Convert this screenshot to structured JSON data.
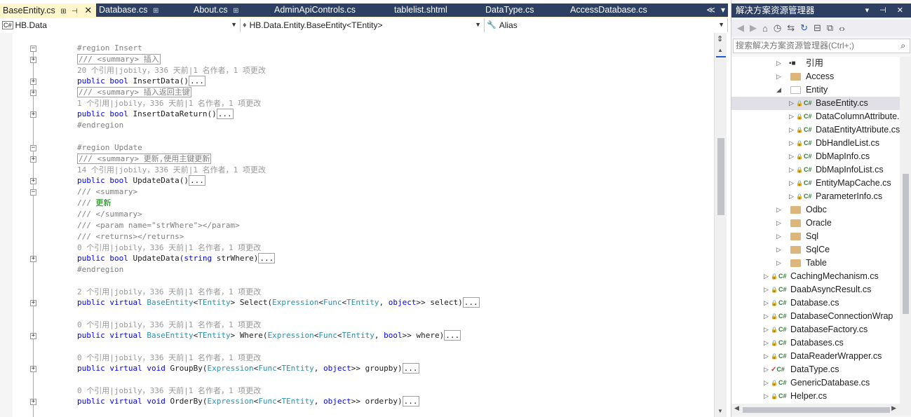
{
  "tabs": [
    {
      "label": "BaseEntity.cs",
      "active": true,
      "pin": "⊞",
      "pin2": "⊣",
      "close": "✕"
    },
    {
      "label": "Database.cs",
      "pin": "⊞"
    },
    {
      "label": "About.cs",
      "pin": "⊞"
    },
    {
      "label": "AdminApiControls.cs"
    },
    {
      "label": "tablelist.shtml"
    },
    {
      "label": "DataType.cs"
    },
    {
      "label": "AccessDatabase.cs"
    }
  ],
  "tab_overflow": {
    "left": "≪",
    "menu": "▾"
  },
  "navbar": {
    "project": "HB.Data",
    "project_icon": "C#",
    "class": "HB.Data.Entity.BaseEntity<TEntity>",
    "member": "Alias"
  },
  "code": {
    "region_insert": "#region Insert",
    "sum_insert": "/// <summary> 插入",
    "lens1": "20 个引用|jobily，336 天前|1 名作者，1 项更改",
    "insertdata_a": "public bool ",
    "insertdata_b": "InsertData()",
    "ellipsis": "...",
    "sum_insert_ret": "/// <summary> 插入返回主键",
    "lens2": "1 个引用|jobily，336 天前|1 名作者，1 项更改",
    "insertret_b": "InsertDataReturn()",
    "endregion": "#endregion",
    "region_update": "#region Update",
    "sum_update": "/// <summary> 更新,使用主键更新",
    "lens3": "14 个引用|jobily，336 天前|1 名作者，1 项更改",
    "updatedata_b": "UpdateData()",
    "doc_summary": "/// <summary>",
    "doc_prefix": "/// ",
    "doc_update_text": "更新",
    "doc_summary_end": "/// </summary>",
    "doc_param": "/// <param name=\"strWhere\"></param>",
    "doc_returns": "/// <returns></returns>",
    "lens4": "0 个引用|jobily，336 天前|1 名作者，1 项更改",
    "updatestr_kw1": "public bool ",
    "updatestr_b": "UpdateData(",
    "kw_string": "string",
    "updatestr_c": " strWhere)",
    "endregion2": "#endregion",
    "lens5": "2 个引用|jobily，336 天前|1 名作者，1 项更改",
    "pv": "public virtual ",
    "t_baseentity": "BaseEntity",
    "t_lt": "<",
    "t_tentity": "TEntity",
    "t_gt": "> ",
    "select_name": "Select(",
    "t_expr": "Expression",
    "t_func": "Func",
    "comma": ", ",
    "kw_object": "object",
    "select_tail": ">> select)",
    "lens6": "0 个引用|jobily，336 天前|1 名作者，1 项更改",
    "where_name": "Where(",
    "kw_bool": "bool",
    "where_tail": ">> where)",
    "lens7": "0 个引用|jobily，336 天前|1 名作者，1 项更改",
    "kw_void": "void ",
    "groupby_name": "GroupBy(",
    "groupby_tail": ">> groupby)",
    "lens8": "0 个引用|jobily，336 天前|1 名作者，1 项更改",
    "orderby_name": "OrderBy(",
    "orderby_tail": ">> orderby)"
  },
  "solution_explorer": {
    "title": "解决方案资源管理器",
    "title_controls": "▾ ⊣ ✕",
    "search_placeholder": "搜索解决方案资源管理器(Ctrl+;)",
    "toolbar_icons": [
      "back-icon",
      "forward-icon",
      "home-icon",
      "history-icon",
      "sync-icon",
      "refresh-icon",
      "collapse-all-icon",
      "copy-icon",
      "code-view-icon"
    ],
    "items": [
      {
        "label": "引用",
        "kind": "ref",
        "level": 1
      },
      {
        "label": "Access",
        "kind": "folder",
        "level": 1
      },
      {
        "label": "Entity",
        "kind": "folder-open",
        "level": 1,
        "expanded": true
      },
      {
        "label": "BaseEntity.cs",
        "kind": "cs",
        "level": 2,
        "selected": true
      },
      {
        "label": "DataColumnAttribute.cs",
        "kind": "cs",
        "level": 2
      },
      {
        "label": "DataEntityAttribute.cs",
        "kind": "cs",
        "level": 2
      },
      {
        "label": "DbHandleList.cs",
        "kind": "cs",
        "level": 2
      },
      {
        "label": "DbMapInfo.cs",
        "kind": "cs",
        "level": 2
      },
      {
        "label": "DbMapInfoList.cs",
        "kind": "cs",
        "level": 2
      },
      {
        "label": "EntityMapCache.cs",
        "kind": "cs",
        "level": 2
      },
      {
        "label": "ParameterInfo.cs",
        "kind": "cs",
        "level": 2
      },
      {
        "label": "Odbc",
        "kind": "folder",
        "level": 1
      },
      {
        "label": "Oracle",
        "kind": "folder",
        "level": 1
      },
      {
        "label": "Sql",
        "kind": "folder",
        "level": 1
      },
      {
        "label": "SqlCe",
        "kind": "folder",
        "level": 1
      },
      {
        "label": "Table",
        "kind": "folder",
        "level": 1
      },
      {
        "label": "CachingMechanism.cs",
        "kind": "cs",
        "level": 0
      },
      {
        "label": "DaabAsyncResult.cs",
        "kind": "cs",
        "level": 0
      },
      {
        "label": "Database.cs",
        "kind": "cs",
        "level": 0
      },
      {
        "label": "DatabaseConnectionWrap",
        "kind": "cs",
        "level": 0
      },
      {
        "label": "DatabaseFactory.cs",
        "kind": "cs",
        "level": 0
      },
      {
        "label": "Databases.cs",
        "kind": "cs",
        "level": 0
      },
      {
        "label": "DataReaderWrapper.cs",
        "kind": "cs",
        "level": 0
      },
      {
        "label": "DataType.cs",
        "kind": "cs-modified",
        "level": 0
      },
      {
        "label": "GenericDatabase.cs",
        "kind": "cs",
        "level": 0
      },
      {
        "label": "Helper.cs",
        "kind": "cs",
        "level": 0
      }
    ]
  }
}
